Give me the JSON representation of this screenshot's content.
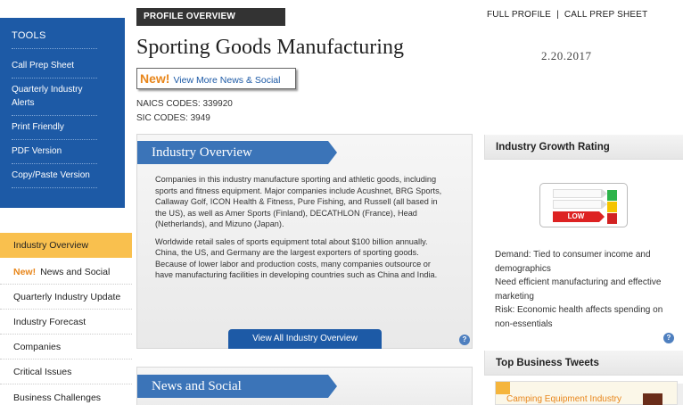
{
  "tools": {
    "heading": "TOOLS",
    "items": [
      "Call Prep Sheet",
      "Quarterly Industry Alerts",
      "Print Friendly",
      "PDF Version",
      "Copy/Paste Version"
    ]
  },
  "nav": {
    "expand_symbol": "+",
    "new_label": "New!",
    "items": [
      "Industry Overview",
      "News and Social",
      "Quarterly Industry Update",
      "Industry Forecast",
      "Companies",
      "Critical Issues",
      "Business Challenges"
    ]
  },
  "header": {
    "section_label": "PROFILE OVERVIEW",
    "full_profile": "FULL PROFILE",
    "separator": "|",
    "call_prep": "CALL PREP SHEET",
    "title": "Sporting Goods Manufacturing",
    "date": "2.20.2017",
    "news_button": {
      "new_label": "New!",
      "label": "View More News & Social"
    },
    "naics": "NAICS CODES: 339920",
    "sic": "SIC CODES: 3949"
  },
  "overview": {
    "title": "Industry Overview",
    "paragraphs": [
      "Companies in this industry manufacture sporting and athletic goods, including sports and fitness equipment. Major companies include Acushnet, BRG Sports, Callaway Golf, ICON Health & Fitness, Pure Fishing, and Russell (all based in the US), as well as Amer Sports (Finland), DECATHLON (France), Head (Netherlands), and Mizuno (Japan).",
      "Worldwide retail sales of sports equipment total about $100 billion annually. China, the US, and Germany are the largest exporters of sporting goods. Because of lower labor and production costs, many companies outsource or have manufacturing facilities in developing countries such as China and India."
    ],
    "button": "View All Industry Overview",
    "help": "?"
  },
  "news": {
    "title": "News and Social"
  },
  "growth": {
    "title": "Industry Growth Rating",
    "rating": "LOW",
    "light_colors": [
      "#2db34a",
      "#f5c400",
      "#d22222"
    ],
    "lines": [
      "Demand: Tied to consumer income and demographics",
      "Need efficient manufacturing and effective marketing",
      "Risk: Economic health affects spending on non-essentials"
    ],
    "help": "?"
  },
  "tweets": {
    "title": "Top Business Tweets",
    "first": "Camping Equipment Industry"
  }
}
